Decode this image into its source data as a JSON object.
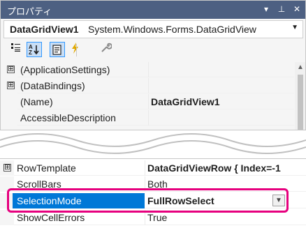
{
  "panel_title": "プロパティ",
  "title_buttons": {
    "dropdown": "▾",
    "pin": "⊥",
    "close": "✕"
  },
  "object_selector": {
    "name": "DataGridView1",
    "type": "System.Windows.Forms.DataGridView"
  },
  "toolbar": {
    "categorized": "categorized-icon",
    "alphabetical": "alphabetical-icon",
    "properties": "properties-icon",
    "events": "events-icon",
    "property_pages": "wrench-icon"
  },
  "colors": {
    "title_bar": "#4d6082",
    "selection": "#0078d7",
    "highlight_border": "#e6007e"
  },
  "top_rows": [
    {
      "expander": "⊞",
      "name": "(ApplicationSettings)",
      "value": ""
    },
    {
      "expander": "⊞",
      "name": "(DataBindings)",
      "value": ""
    },
    {
      "expander": "",
      "name": "(Name)",
      "value": "DataGridView1"
    },
    {
      "expander": "",
      "name": "AccessibleDescription",
      "value": ""
    }
  ],
  "bottom_rows": [
    {
      "expander": "⊞",
      "name": "RowTemplate",
      "value": "DataGridViewRow { Index=-1"
    },
    {
      "expander": "",
      "name": "ScrollBars",
      "value": "Both"
    },
    {
      "expander": "",
      "name": "SelectionMode",
      "value": "FullRowSelect",
      "selected": true
    },
    {
      "expander": "",
      "name": "ShowCellErrors",
      "value": "True"
    }
  ]
}
